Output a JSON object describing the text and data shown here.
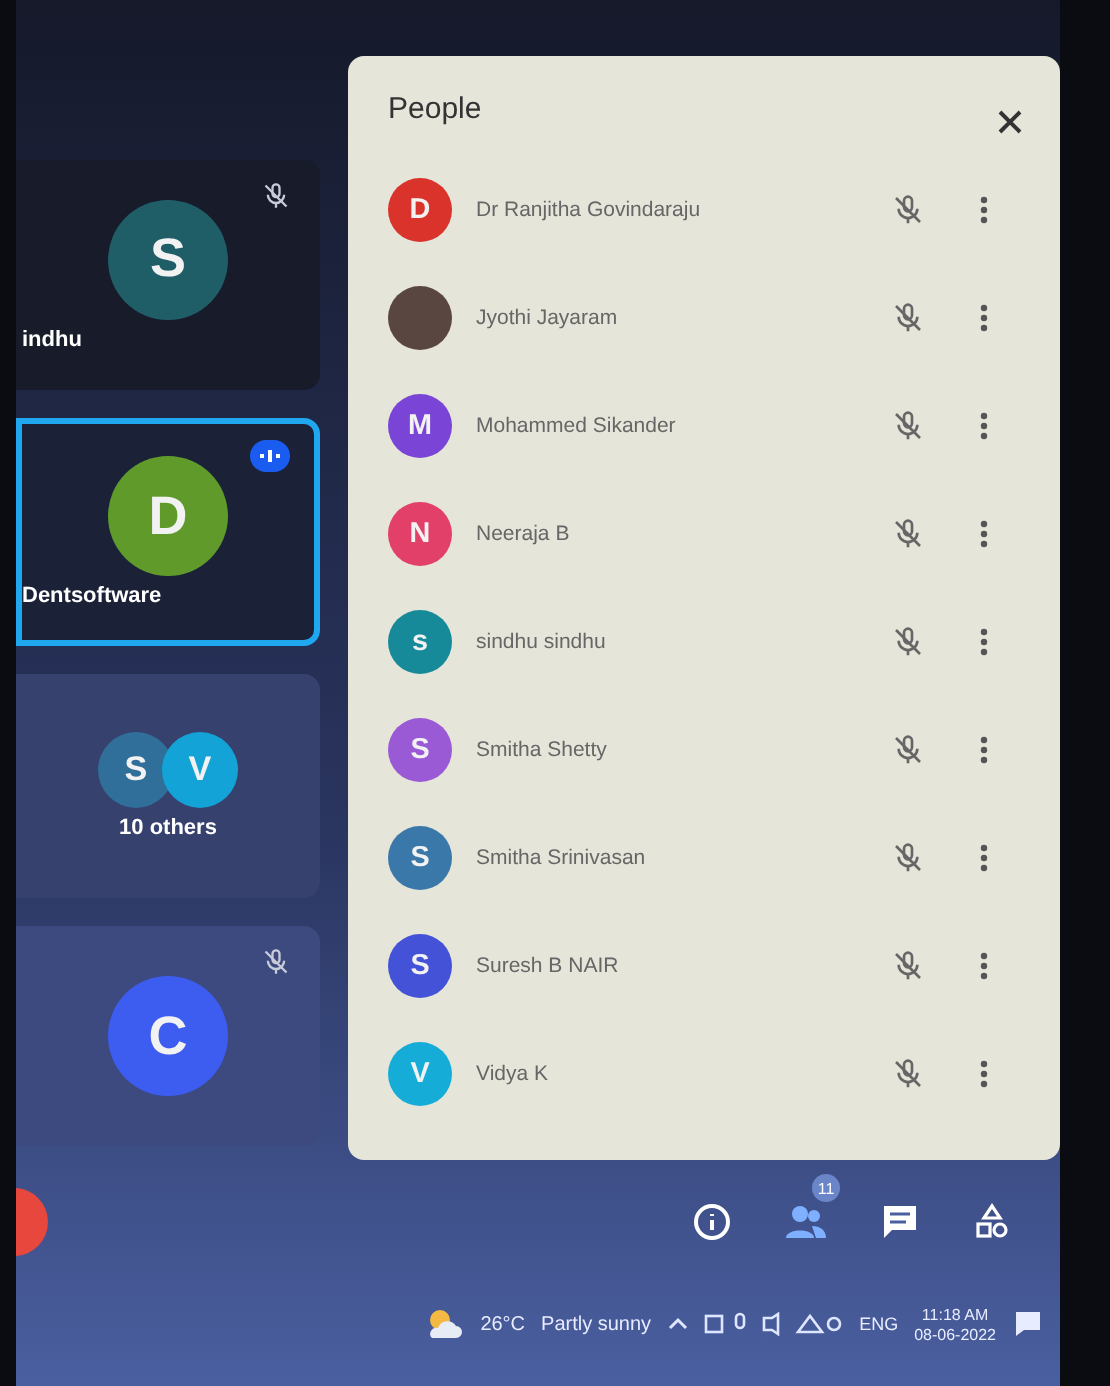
{
  "tiles": [
    {
      "kind": "single",
      "avatars": [
        {
          "initial": "S",
          "color": "#1f5e66"
        }
      ],
      "name": "indhu",
      "speaking": false,
      "muted": true
    },
    {
      "kind": "single",
      "avatars": [
        {
          "initial": "D",
          "color": "#5f9a2a"
        }
      ],
      "name": "Dentsoftware",
      "speaking": true,
      "muted": false
    },
    {
      "kind": "group",
      "avatars": [
        {
          "initial": "S",
          "color": "#2f6f9a"
        },
        {
          "initial": "V",
          "color": "#13a3d6"
        }
      ],
      "name": "10 others",
      "speaking": false,
      "muted": false
    },
    {
      "kind": "single",
      "avatars": [
        {
          "initial": "C",
          "color": "#3d5cf0"
        }
      ],
      "speaking": false,
      "muted": true
    }
  ],
  "people": {
    "title": "People",
    "participants": [
      {
        "name": "Dr Ranjitha Govindaraju",
        "kind": "initial",
        "initial": "D",
        "color": "#d9332b",
        "muted": true
      },
      {
        "name": "Jyothi Jayaram",
        "kind": "photo",
        "color": "#5a4640",
        "muted": true
      },
      {
        "name": "Mohammed Sikander",
        "kind": "initial",
        "initial": "M",
        "color": "#7a44d6",
        "muted": true
      },
      {
        "name": "Neeraja B",
        "kind": "initial",
        "initial": "N",
        "color": "#e23f69",
        "muted": true
      },
      {
        "name": "sindhu sindhu",
        "kind": "initial",
        "initial": "s",
        "color": "#178a9a",
        "muted": true
      },
      {
        "name": "Smitha Shetty",
        "kind": "initial",
        "initial": "S",
        "color": "#9a5ad6",
        "muted": true
      },
      {
        "name": "Smitha Srinivasan",
        "kind": "initial",
        "initial": "S",
        "color": "#3b78aa",
        "muted": true
      },
      {
        "name": "Suresh B NAIR",
        "kind": "initial",
        "initial": "S",
        "color": "#4452d8",
        "muted": true
      },
      {
        "name": "Vidya K",
        "kind": "initial",
        "initial": "V",
        "color": "#16acd8",
        "muted": true
      }
    ]
  },
  "toolbar": {
    "people_count": "11"
  },
  "taskbar": {
    "temperature": "26°C",
    "weather": "Partly sunny",
    "language": "ENG",
    "time": "11:18 AM",
    "date": "08-06-2022"
  }
}
